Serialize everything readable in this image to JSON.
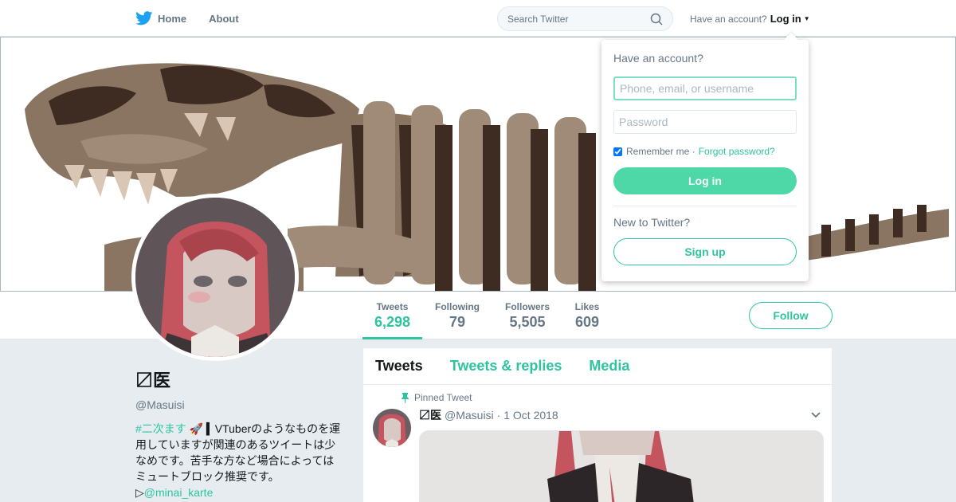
{
  "nav": {
    "home_label": "Home",
    "about_label": "About",
    "search_placeholder": "Search Twitter",
    "account_prompt": "Have an account?",
    "login_label": "Log in"
  },
  "profile": {
    "display_name": "〼医",
    "handle": "@Masuisi",
    "bio_hashtag": "#二次ます",
    "bio_text": " 🚀 ▍VTuberのようなものを運用していますが関連のあるツイートは少なめです。苦手な方など場合によってはミュートブロック推奨です。",
    "bio_link_prefix": "▷",
    "bio_mention": "@minai_karte"
  },
  "stats": [
    {
      "label": "Tweets",
      "value": "6,298"
    },
    {
      "label": "Following",
      "value": "79"
    },
    {
      "label": "Followers",
      "value": "5,505"
    },
    {
      "label": "Likes",
      "value": "609"
    }
  ],
  "follow_label": "Follow",
  "timeline": {
    "tabs": [
      "Tweets",
      "Tweets & replies",
      "Media"
    ],
    "pinned_label": "Pinned Tweet",
    "tweet": {
      "name": "〼医",
      "handle": "@Masuisi",
      "date": "· 1 Oct 2018"
    }
  },
  "login_dropdown": {
    "title": "Have an account?",
    "username_placeholder": "Phone, email, or username",
    "password_placeholder": "Password",
    "remember_label": "Remember me ·",
    "forgot_label": "Forgot password?",
    "login_button": "Log in",
    "new_prompt": "New to Twitter?",
    "signup_button": "Sign up"
  },
  "colors": {
    "accent": "#2ec4a0",
    "login_button": "#4ed8a8",
    "twitter_blue": "#1da1f2"
  }
}
